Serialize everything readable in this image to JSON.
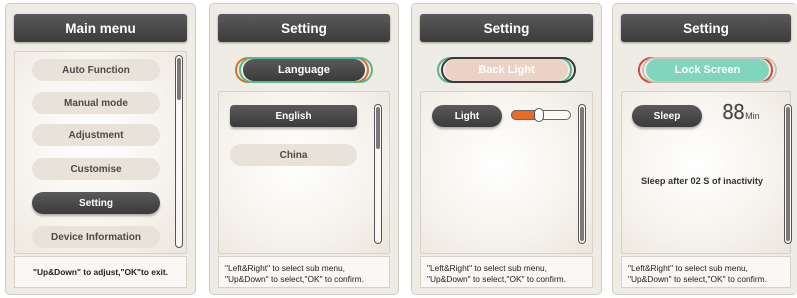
{
  "colors": {
    "panel_bg": "#efece6",
    "title_bar": "#3f3f3f",
    "slider_fill": "#ea6a2a",
    "lock_screen_tab": "#7fd6bd",
    "back_light_tab": "#ecd2c4"
  },
  "panel1": {
    "title": "Main menu",
    "items": [
      {
        "label": "Auto Function"
      },
      {
        "label": "Manual mode"
      },
      {
        "label": "Adjustment"
      },
      {
        "label": "Customise"
      },
      {
        "label": "Setting",
        "selected": true
      },
      {
        "label": "Device Information"
      }
    ],
    "footer": "\"Up&Down\" to adjust,\"OK\"to exit."
  },
  "panel2": {
    "title": "Setting",
    "tab": "Language",
    "options": [
      {
        "label": "English",
        "selected": true
      },
      {
        "label": "China"
      }
    ],
    "footer_line1": "\"Left&Right\" to select sub menu,",
    "footer_line2": "\"Up&Down\" to select,\"OK\" to confirm."
  },
  "panel3": {
    "title": "Setting",
    "tab": "Back Light",
    "light_label": "Light",
    "light_level": 0.45,
    "footer_line1": "\"Left&Right\" to select sub menu,",
    "footer_line2": "\"Up&Down\" to select,\"OK\" to confirm."
  },
  "panel4": {
    "title": "Setting",
    "tab": "Lock Screen",
    "sleep_label": "Sleep",
    "sleep_value": "88",
    "sleep_unit": "Min",
    "sleep_message": "Sleep after 02 S of inactivity",
    "footer_line1": "\"Left&Right\" to select sub menu,",
    "footer_line2": "\"Up&Down\" to select,\"OK\" to confirm."
  }
}
